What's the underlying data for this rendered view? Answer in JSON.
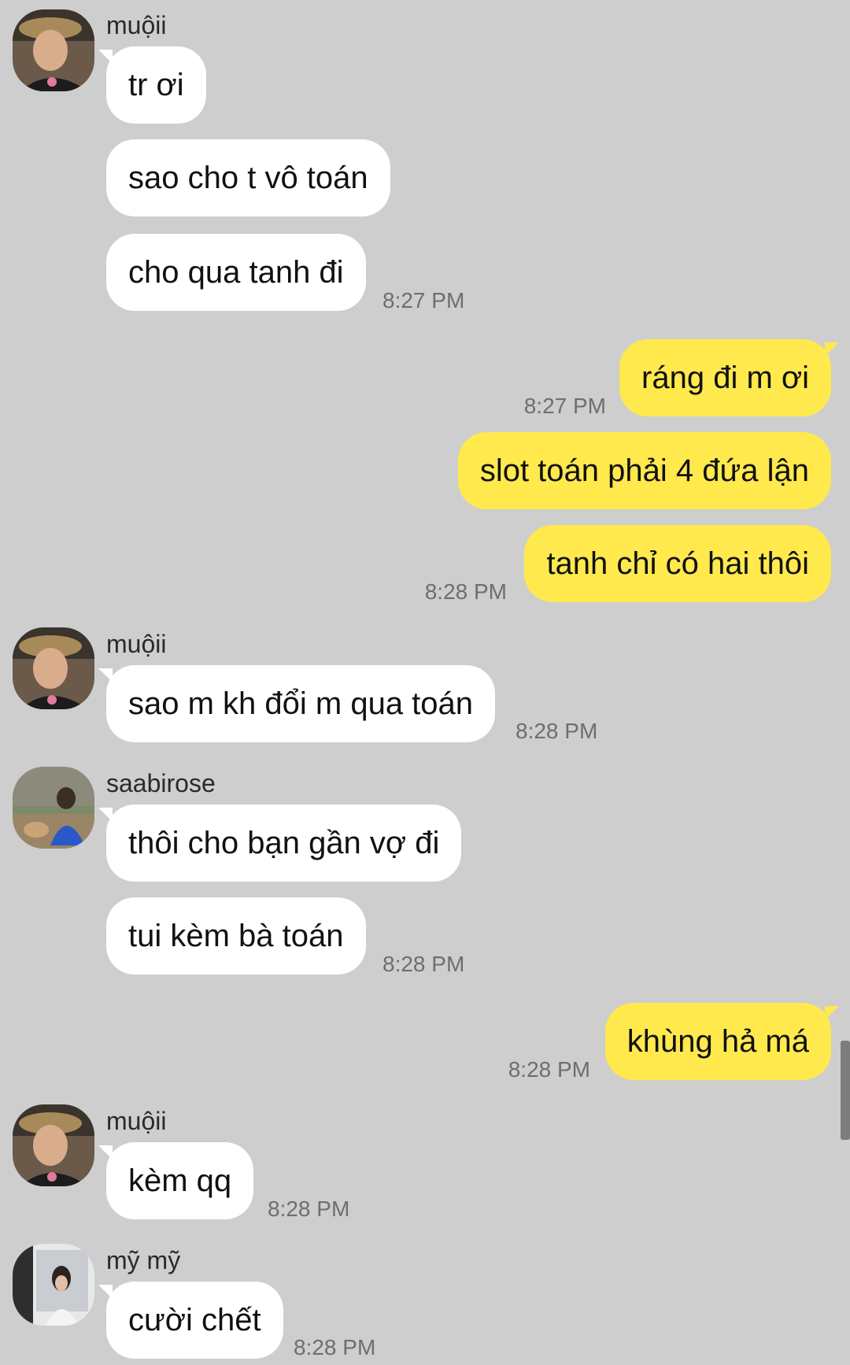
{
  "messages": [
    {
      "sender": "muộii",
      "avatar": "avatar-muoii",
      "texts": [
        "tr ơi",
        "sao cho t vô toán",
        "cho qua tanh đi"
      ],
      "time": "8:27 PM"
    },
    {
      "sender": "me",
      "texts": [
        "ráng đi m ơi"
      ],
      "time": "8:27 PM"
    },
    {
      "sender": "me",
      "texts": [
        "slot toán phải 4 đứa lận",
        "tanh chỉ có hai thôi"
      ],
      "time": "8:28 PM"
    },
    {
      "sender": "muộii",
      "avatar": "avatar-muoii",
      "texts": [
        "sao m kh đổi m qua toán"
      ],
      "time": "8:28 PM"
    },
    {
      "sender": "saabirose",
      "avatar": "avatar-saabirose",
      "texts": [
        "thôi cho bạn gần vợ đi",
        "tui kèm bà toán"
      ],
      "time": "8:28 PM"
    },
    {
      "sender": "me",
      "texts": [
        "khùng hả má"
      ],
      "time": "8:28 PM"
    },
    {
      "sender": "muộii",
      "avatar": "avatar-muoii",
      "texts": [
        "kèm qq"
      ],
      "time": "8:28 PM"
    },
    {
      "sender": "mỹ mỹ",
      "avatar": "avatar-my-my",
      "texts": [
        "cười chết"
      ],
      "time": "8:28 PM"
    }
  ],
  "colors": {
    "background": "#cecece",
    "incoming_bubble": "#ffffff",
    "outgoing_bubble": "#ffe94d",
    "timestamp": "#6e6e6e"
  }
}
